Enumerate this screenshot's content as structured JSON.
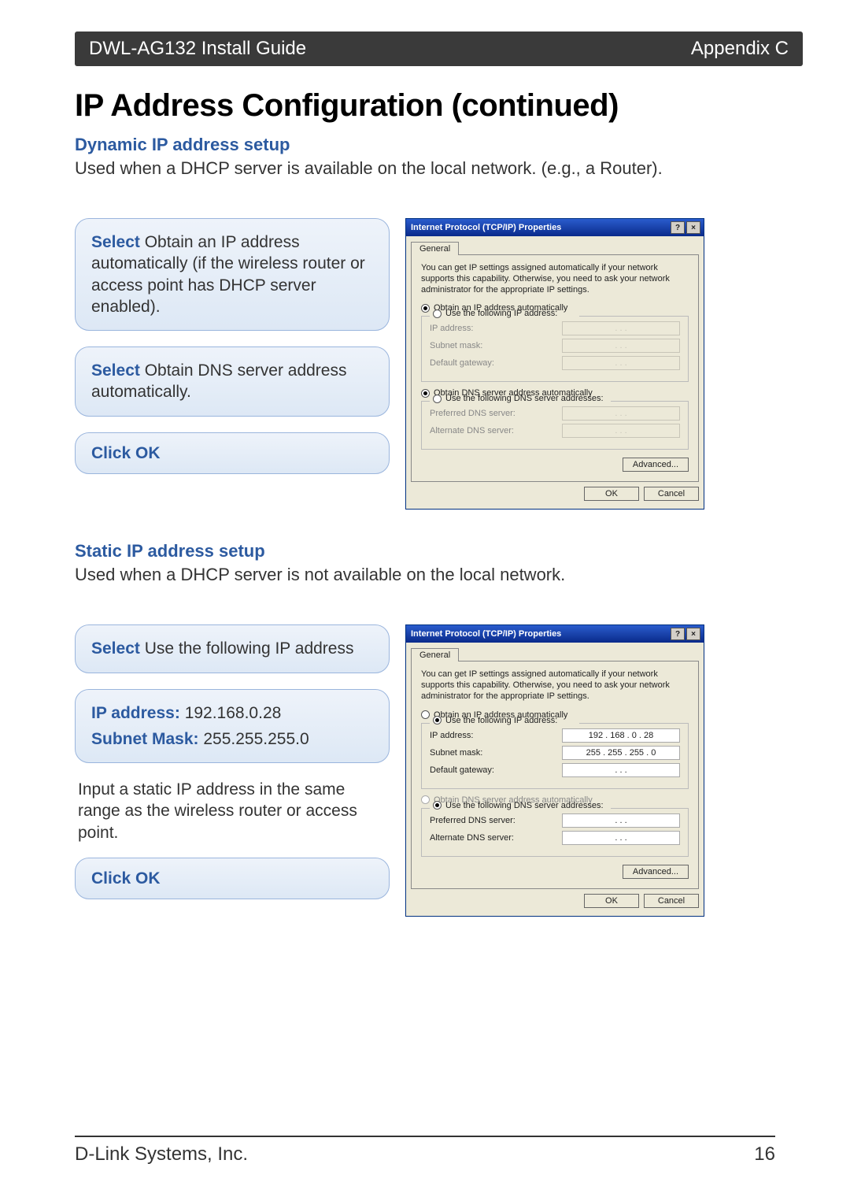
{
  "header": {
    "left": "DWL-AG132 Install Guide",
    "right": "Appendix C"
  },
  "title": "IP Address Configuration (continued)",
  "dynamic": {
    "heading": "Dynamic IP address setup",
    "desc": "Used when a DHCP server is available on the local network. (e.g., a Router).",
    "callout1_strong": "Select",
    "callout1_rest": " Obtain an IP address automatically (if the wireless router or access point has DHCP server enabled).",
    "callout2_strong": "Select",
    "callout2_rest": " Obtain DNS server address automatically.",
    "callout3": "Click OK"
  },
  "static": {
    "heading": "Static IP address setup",
    "desc": "Used when a DHCP server is not available on the local network.",
    "callout1_strong": "Select",
    "callout1_rest": " Use the following IP address",
    "ip_label": "IP address:",
    "ip_value": "192.168.0.28",
    "mask_label": "Subnet Mask:",
    "mask_value": "255.255.255.0",
    "note": "Input a static IP address in the same range as the wireless router or access point.",
    "callout_ok": "Click OK"
  },
  "dialog": {
    "title": "Internet Protocol (TCP/IP) Properties",
    "help_btn": "?",
    "close_btn": "×",
    "tab": "General",
    "info": "You can get IP settings assigned automatically if your network supports this capability. Otherwise, you need to ask your network administrator for the appropriate IP settings.",
    "radio_obtain_ip": "Obtain an IP address automatically",
    "radio_use_ip": "Use the following IP address:",
    "lbl_ip": "IP address:",
    "lbl_mask": "Subnet mask:",
    "lbl_gw": "Default gateway:",
    "radio_obtain_dns": "Obtain DNS server address automatically",
    "radio_use_dns": "Use the following DNS server addresses:",
    "lbl_pref_dns": "Preferred DNS server:",
    "lbl_alt_dns": "Alternate DNS server:",
    "btn_adv": "Advanced...",
    "btn_ok": "OK",
    "btn_cancel": "Cancel",
    "static_ip": "192 . 168 .   0  .  28",
    "static_mask": "255 . 255 . 255 .   0",
    "dots": ".       .       ."
  },
  "footer": {
    "company": "D-Link Systems, Inc.",
    "page": "16"
  }
}
